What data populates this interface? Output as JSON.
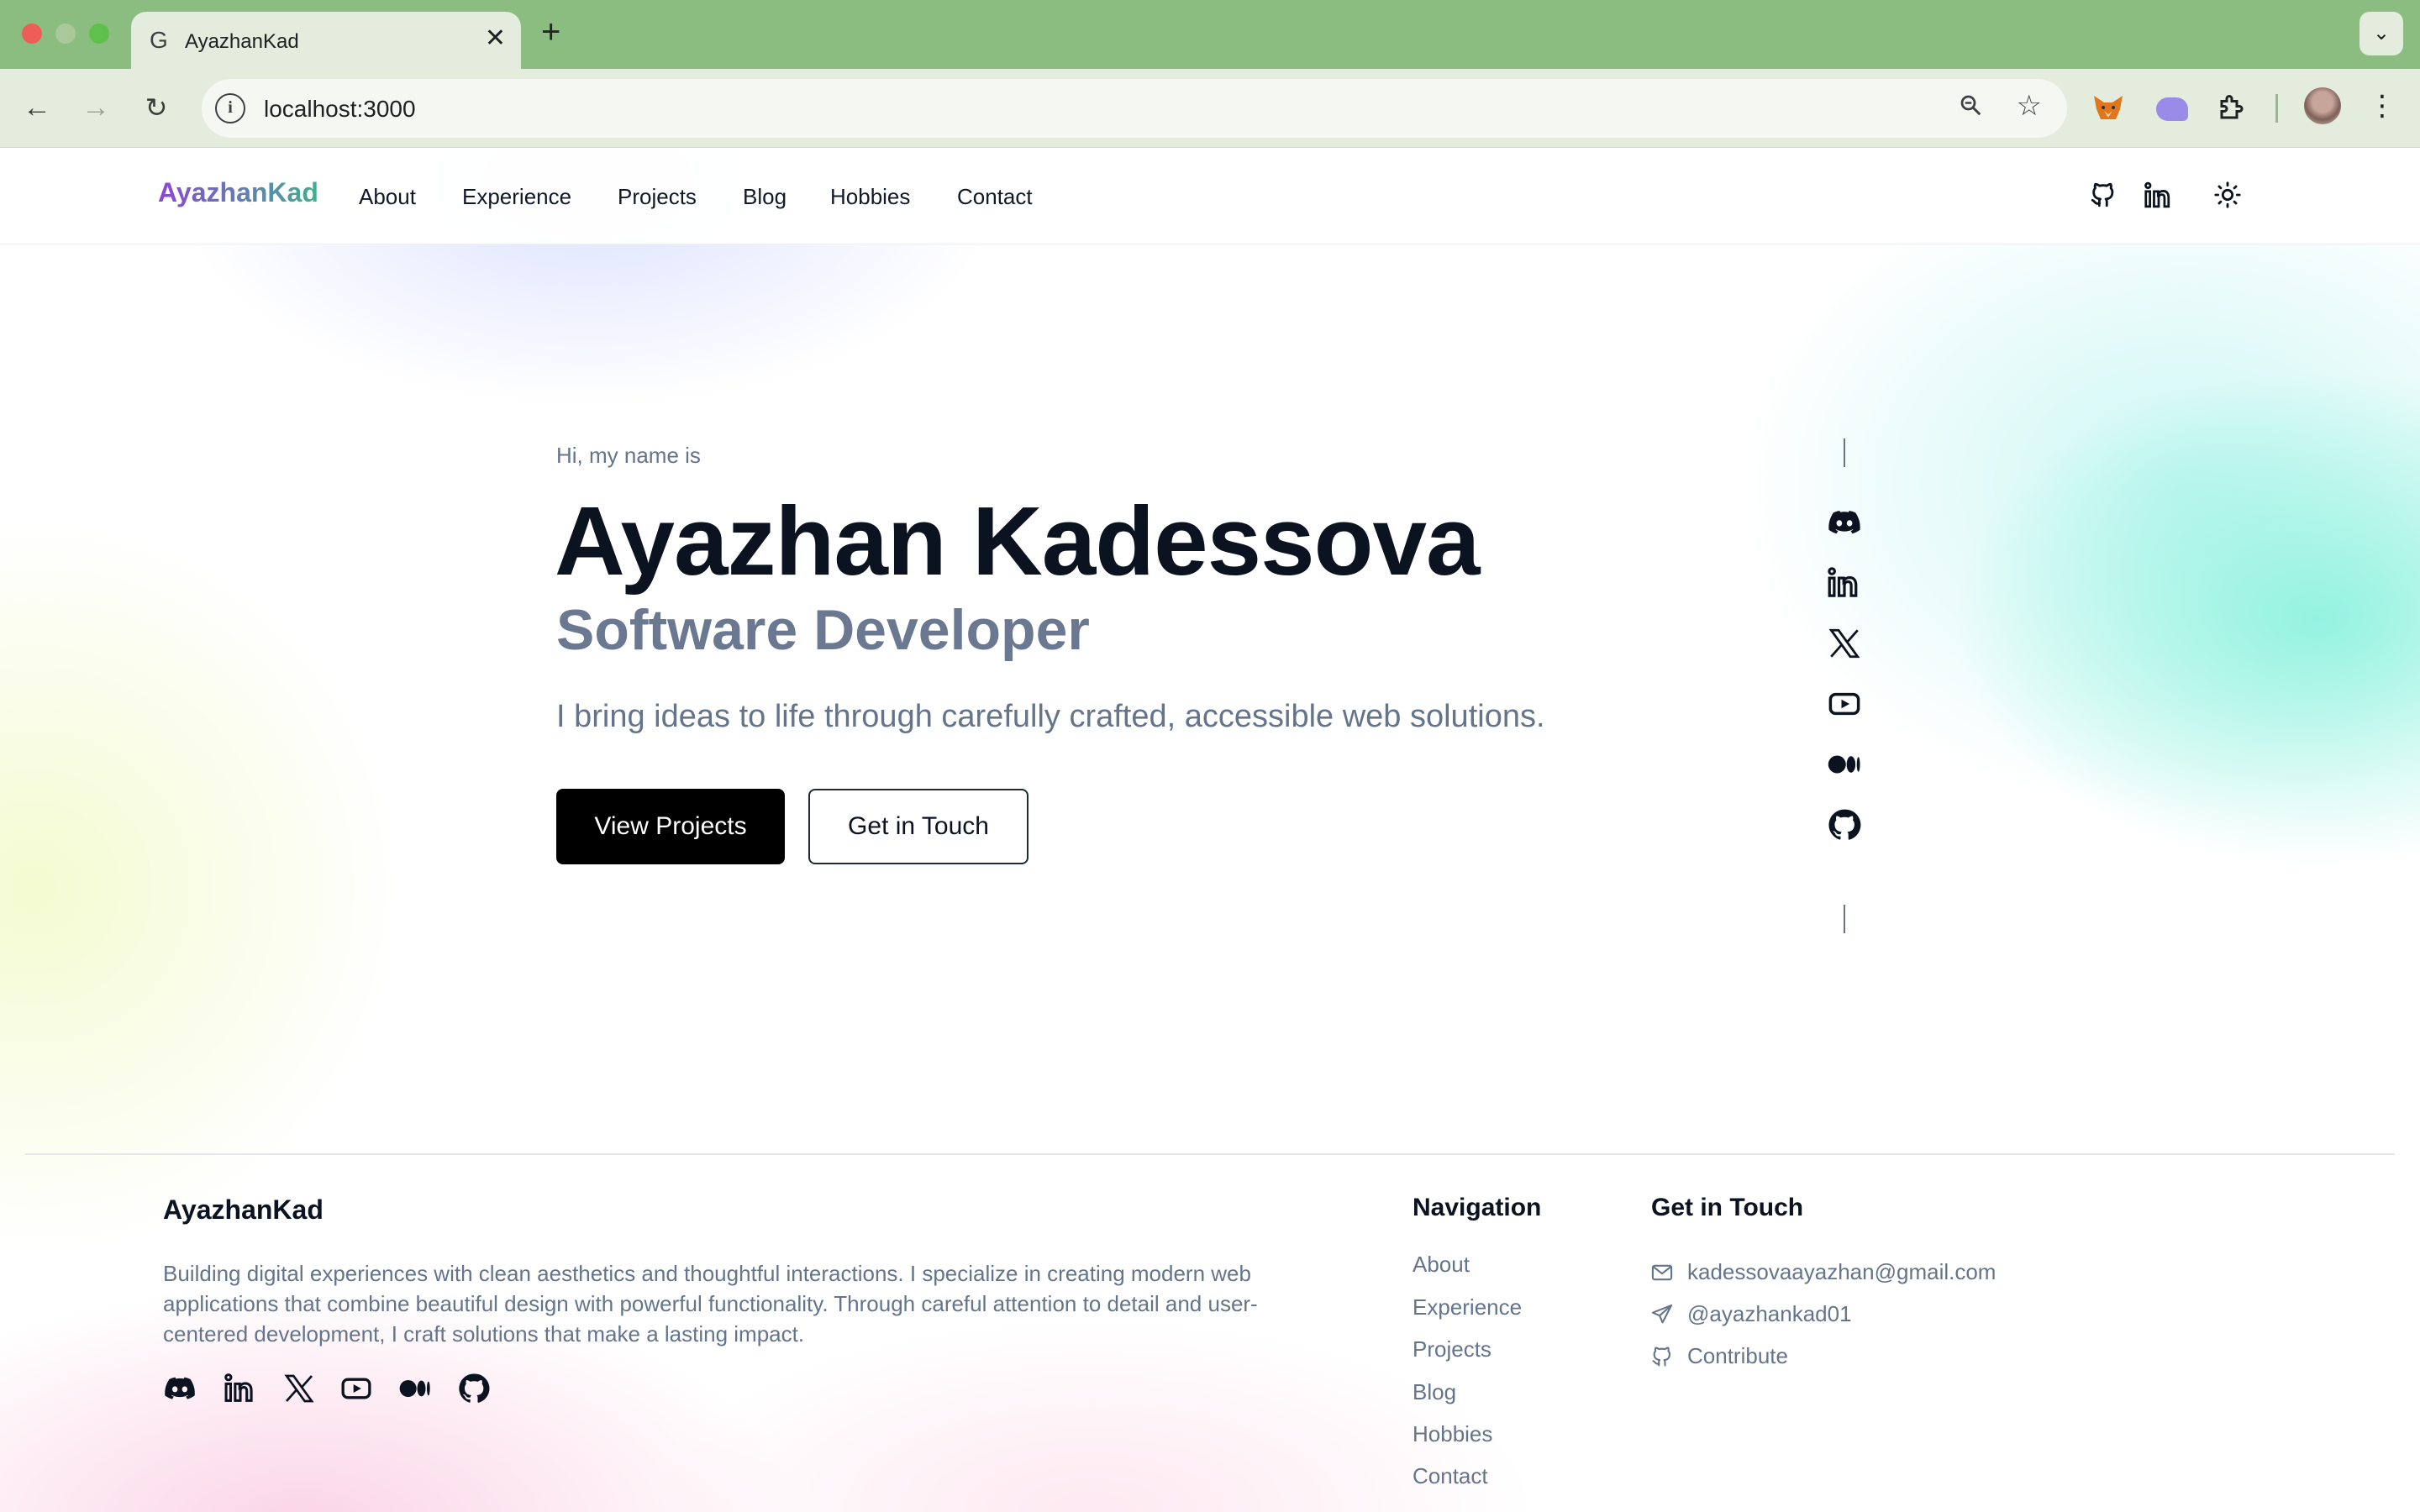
{
  "browser": {
    "tab_title": "AyazhanKad",
    "tab_favicon": "G",
    "url": "localhost:3000",
    "icons": [
      "back-icon",
      "forward-icon",
      "reload-icon",
      "site-info-icon",
      "zoom-icon",
      "bookmark-star-icon",
      "metamask-icon",
      "ghost-extension-icon",
      "extensions-puzzle-icon",
      "profile-avatar",
      "browser-menu-icon"
    ]
  },
  "header": {
    "brand": "AyazhanKad",
    "nav": [
      "About",
      "Experience",
      "Projects",
      "Blog",
      "Hobbies",
      "Contact"
    ],
    "icons": [
      "github-icon",
      "linkedin-icon",
      "theme-toggle-sun-icon"
    ]
  },
  "hero": {
    "intro": "Hi, my name is",
    "name": "Ayazhan Kadessova",
    "role": "Software Developer",
    "tagline": "I bring ideas to life through carefully crafted, accessible web solutions.",
    "primary_button": "View Projects",
    "secondary_button": "Get in Touch"
  },
  "social_rail": [
    "discord-icon",
    "linkedin-icon",
    "x-icon",
    "youtube-icon",
    "medium-icon",
    "github-icon"
  ],
  "footer": {
    "brand": "AyazhanKad",
    "description": "Building digital experiences with clean aesthetics and thoughtful interactions. I specialize in creating modern web applications that combine beautiful design with powerful functionality. Through careful attention to detail and user-centered development, I craft solutions that make a lasting impact.",
    "social": [
      "discord-icon",
      "linkedin-icon",
      "x-icon",
      "youtube-icon",
      "medium-icon",
      "github-icon"
    ],
    "navigation_heading": "Navigation",
    "navigation": [
      "About",
      "Experience",
      "Projects",
      "Blog",
      "Hobbies",
      "Contact"
    ],
    "contact_heading": "Get in Touch",
    "contact": [
      {
        "icon": "mail-icon",
        "text": "kadessovaayazhan@gmail.com"
      },
      {
        "icon": "send-icon",
        "text": "@ayazhankad01"
      },
      {
        "icon": "github-icon",
        "text": "Contribute"
      }
    ]
  },
  "colors": {
    "chrome": "#8cbd80",
    "toolbar": "#e3ecdd",
    "brand_gradient_start": "#8b46d8",
    "brand_gradient_end": "#3fb08f",
    "heading": "#0b1220",
    "muted": "#64748b",
    "role": "#6b7891",
    "primary_button": "#000000"
  }
}
